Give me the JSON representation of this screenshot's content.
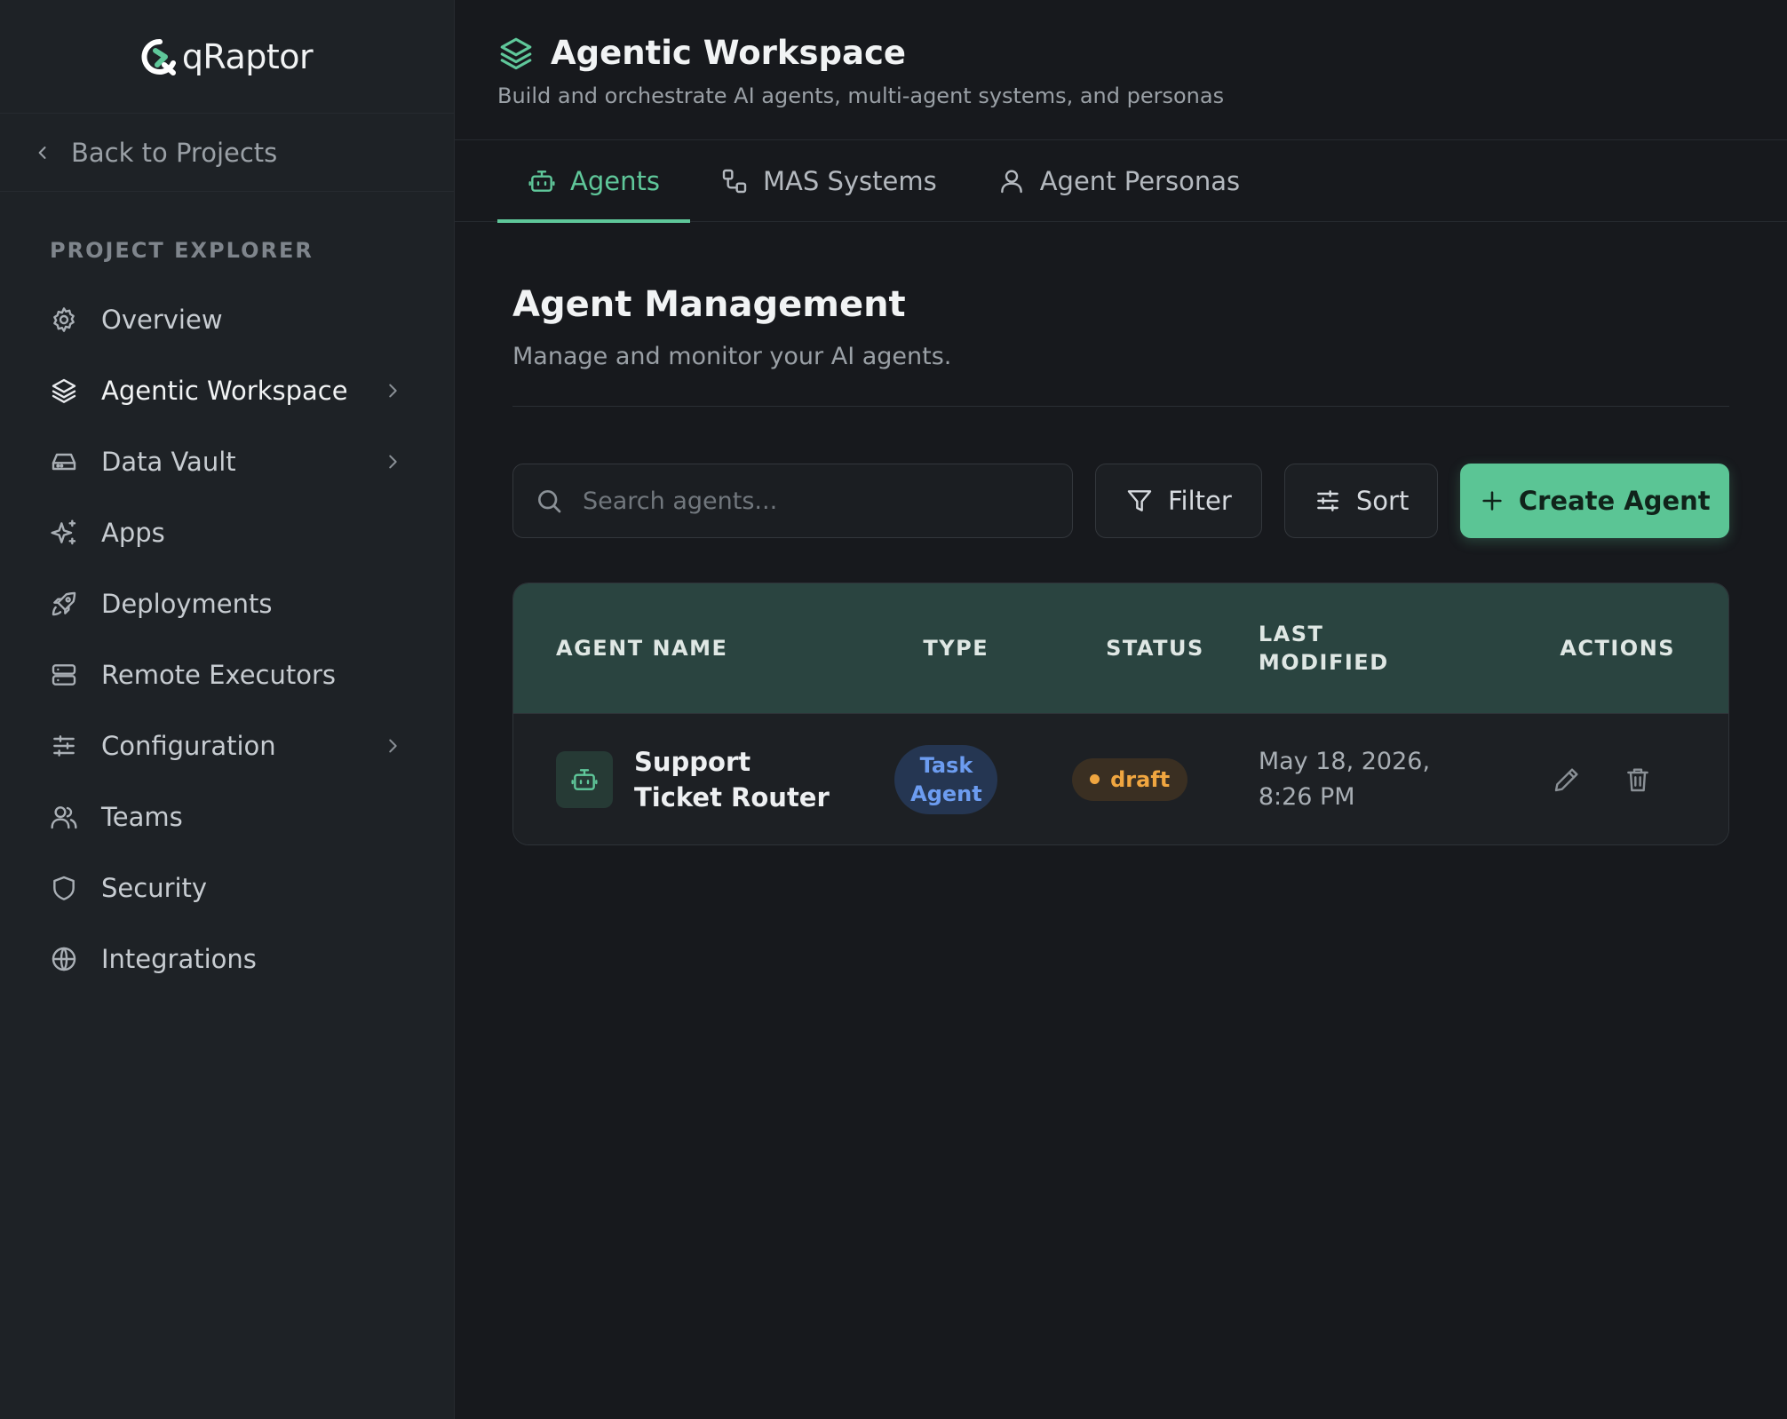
{
  "sidebar": {
    "logo_text": "qRaptor",
    "back_label": "Back to Projects",
    "section_label": "PROJECT EXPLORER",
    "items": [
      {
        "label": "Overview",
        "icon": "gear-icon"
      },
      {
        "label": "Agentic Workspace",
        "icon": "layers-icon"
      },
      {
        "label": "Data Vault",
        "icon": "drive-icon"
      },
      {
        "label": "Apps",
        "icon": "sparkles-icon"
      },
      {
        "label": "Deployments",
        "icon": "rocket-icon"
      },
      {
        "label": "Remote Executors",
        "icon": "server-icon"
      },
      {
        "label": "Configuration",
        "icon": "sliders-icon"
      },
      {
        "label": "Teams",
        "icon": "users-icon"
      },
      {
        "label": "Security",
        "icon": "shield-icon"
      },
      {
        "label": "Integrations",
        "icon": "globe-icon"
      }
    ]
  },
  "header": {
    "title": "Agentic Workspace",
    "subtitle": "Build and orchestrate AI agents, multi-agent systems, and personas"
  },
  "tabs": [
    {
      "label": "Agents",
      "icon": "bot-icon"
    },
    {
      "label": "MAS Systems",
      "icon": "workflow-icon"
    },
    {
      "label": "Agent Personas",
      "icon": "user-icon"
    }
  ],
  "main": {
    "title": "Agent Management",
    "subtitle": "Manage and monitor your AI agents."
  },
  "toolbar": {
    "search_placeholder": "Search agents...",
    "filter_label": "Filter",
    "sort_label": "Sort",
    "create_label": "Create Agent"
  },
  "table": {
    "columns": [
      "AGENT NAME",
      "TYPE",
      "STATUS",
      "LAST MODIFIED",
      "ACTIONS"
    ],
    "rows": [
      {
        "name": "Support Ticket Router",
        "type": "Task Agent",
        "status": "draft",
        "last_modified": "May 18, 2026, 8:26 PM"
      }
    ]
  },
  "colors": {
    "accent": "#5fc79a",
    "background": "#17191d",
    "sidebar": "#1e2226",
    "table_header": "#2a4440",
    "type_badge": "#6c9cf0",
    "status_draft": "#f0a640"
  }
}
